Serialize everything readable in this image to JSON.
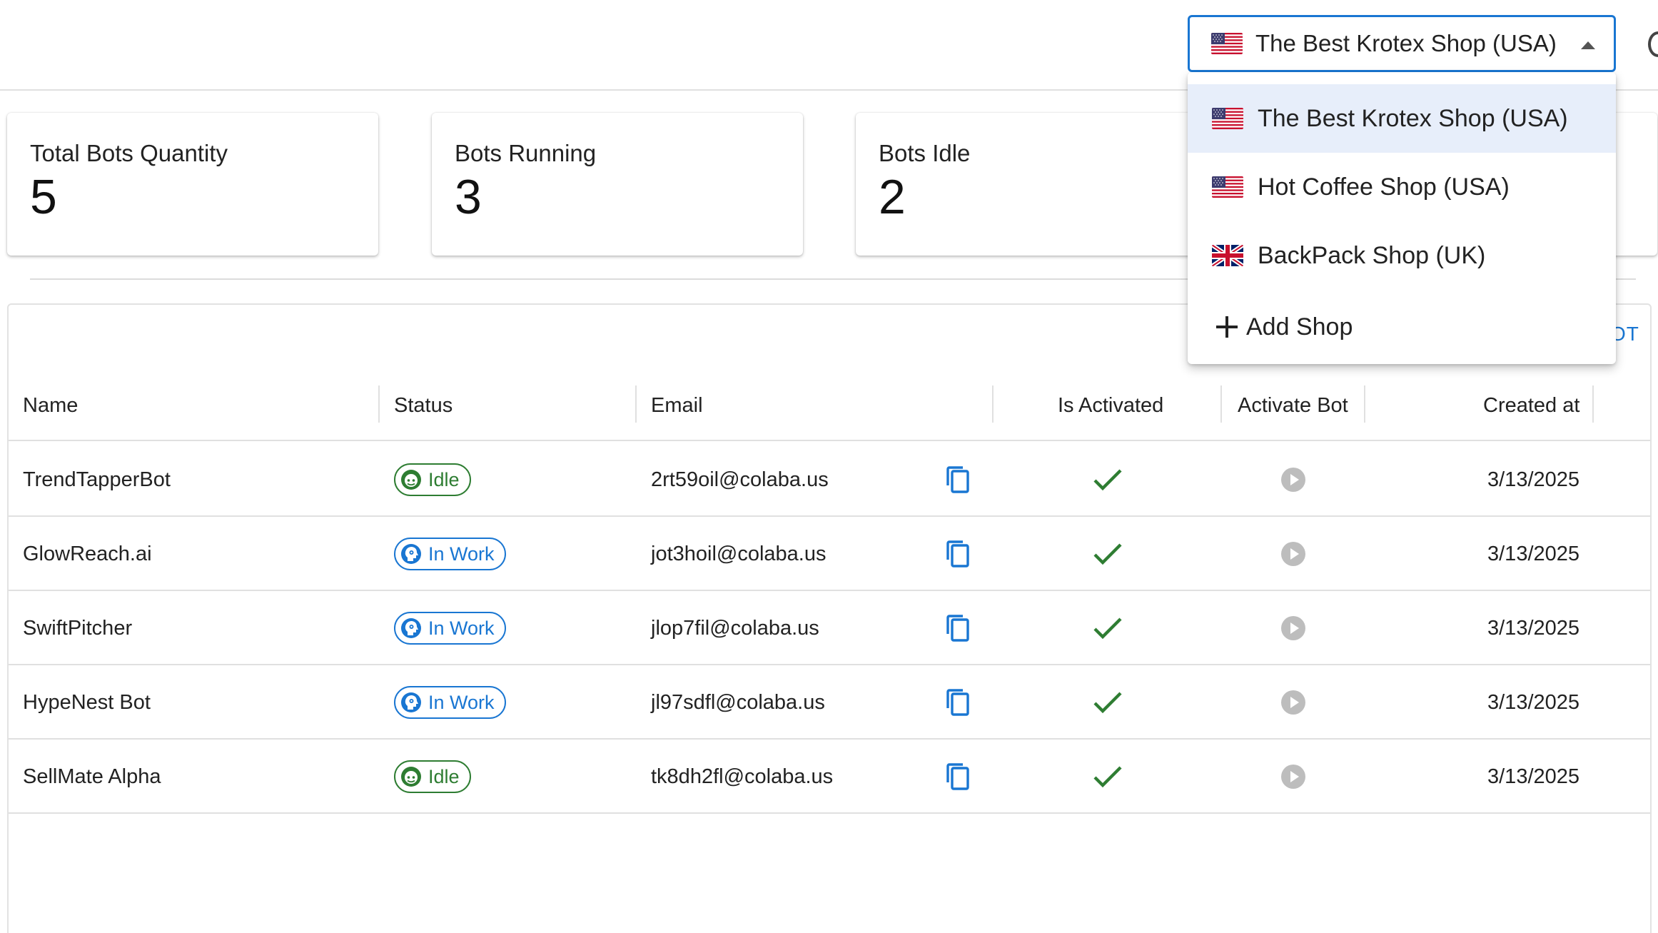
{
  "shop_selector": {
    "selected_label": "The Best Krotex Shop (USA)",
    "selected_flag": "us-flag-icon",
    "options": [
      {
        "label": "The Best Krotex Shop (USA)",
        "flag": "us-flag-icon",
        "selected": true
      },
      {
        "label": "Hot Coffee Shop (USA)",
        "flag": "us-flag-icon",
        "selected": false
      },
      {
        "label": "BackPack Shop (UK)",
        "flag": "uk-flag-icon",
        "selected": false
      }
    ],
    "add_label": "Add Shop"
  },
  "stats": [
    {
      "title": "Total Bots Quantity",
      "value": "5"
    },
    {
      "title": "Bots Running",
      "value": "3"
    },
    {
      "title": "Bots Idle",
      "value": "2"
    }
  ],
  "table": {
    "add_bot_label_fragment": "OT",
    "headers": {
      "name": "Name",
      "status": "Status",
      "email": "Email",
      "is_activated": "Is Activated",
      "activate_bot": "Activate Bot",
      "created_at": "Created at"
    },
    "rows": [
      {
        "name": "TrendTapperBot",
        "status": "Idle",
        "status_kind": "idle",
        "email": "2rt59oil@colaba.us",
        "activated": true,
        "created_at": "3/13/2025"
      },
      {
        "name": "GlowReach.ai",
        "status": "In Work",
        "status_kind": "work",
        "email": "jot3hoil@colaba.us",
        "activated": true,
        "created_at": "3/13/2025"
      },
      {
        "name": "SwiftPitcher",
        "status": "In Work",
        "status_kind": "work",
        "email": "jlop7fil@colaba.us",
        "activated": true,
        "created_at": "3/13/2025"
      },
      {
        "name": "HypeNest Bot",
        "status": "In Work",
        "status_kind": "work",
        "email": "jl97sdfl@colaba.us",
        "activated": true,
        "created_at": "3/13/2025"
      },
      {
        "name": "SellMate Alpha",
        "status": "Idle",
        "status_kind": "idle",
        "email": "tk8dh2fl@colaba.us",
        "activated": true,
        "created_at": "3/13/2025"
      }
    ]
  },
  "colors": {
    "accent": "#1976d2",
    "idle": "#2e7d32",
    "check": "#2e7d32",
    "play_disabled": "#bdbdbd",
    "menu_selected_bg": "#e7eefa"
  }
}
